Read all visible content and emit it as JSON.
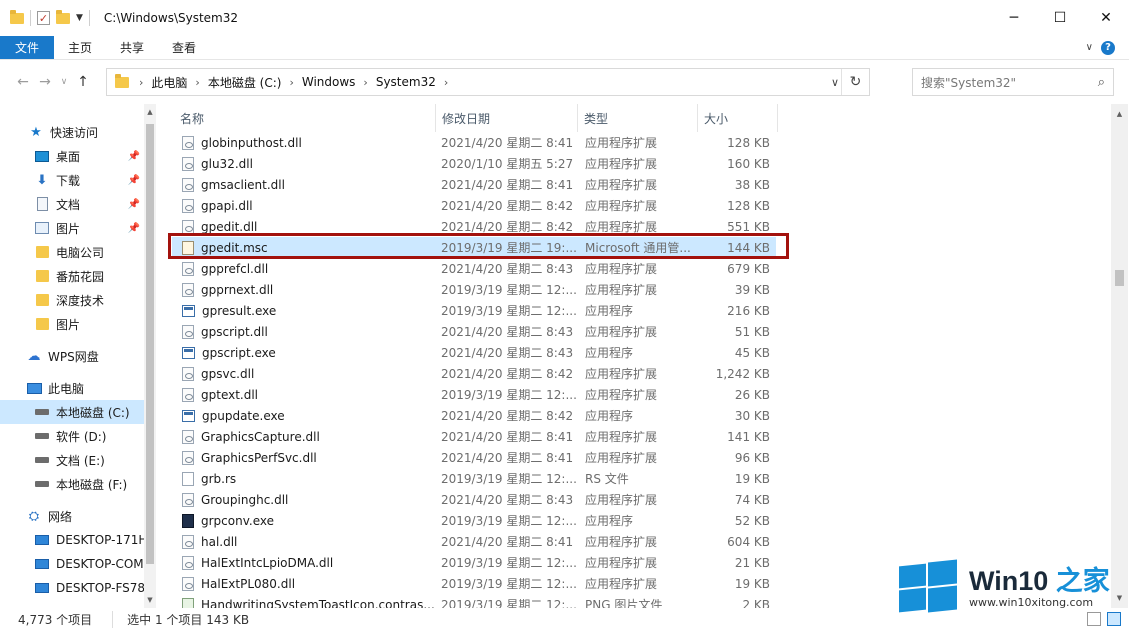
{
  "titlebar": {
    "path": "C:\\Windows\\System32",
    "min": "─",
    "max": "☐",
    "close": "✕"
  },
  "ribbon": {
    "tabs": [
      "文件",
      "主页",
      "共享",
      "查看"
    ],
    "help": "?"
  },
  "address": {
    "crumbs": [
      "此电脑",
      "本地磁盘 (C:)",
      "Windows",
      "System32"
    ],
    "search_placeholder": "搜索\"System32\""
  },
  "nav": [
    {
      "label": "快速访问",
      "icon": "star-icon"
    },
    {
      "label": "桌面",
      "icon": "desktop-icon",
      "pinned": true
    },
    {
      "label": "下载",
      "icon": "download-icon",
      "pinned": true
    },
    {
      "label": "文档",
      "icon": "document-icon",
      "pinned": true
    },
    {
      "label": "图片",
      "icon": "picture-icon",
      "pinned": true
    },
    {
      "label": "电脑公司",
      "icon": "folder-icon"
    },
    {
      "label": "番茄花园",
      "icon": "folder-icon"
    },
    {
      "label": "深度技术",
      "icon": "folder-icon"
    },
    {
      "label": "图片",
      "icon": "folder-icon"
    },
    {
      "label": "WPS网盘",
      "icon": "cloud-icon"
    },
    {
      "label": "此电脑",
      "icon": "computer-icon"
    },
    {
      "label": "本地磁盘 (C:)",
      "icon": "drive-icon",
      "selected": true
    },
    {
      "label": "软件 (D:)",
      "icon": "drive-icon"
    },
    {
      "label": "文档 (E:)",
      "icon": "drive-icon"
    },
    {
      "label": "本地磁盘 (F:)",
      "icon": "drive-icon"
    },
    {
      "label": "网络",
      "icon": "network-icon"
    },
    {
      "label": "DESKTOP-171H",
      "icon": "monitor-icon"
    },
    {
      "label": "DESKTOP-COM",
      "icon": "monitor-icon"
    },
    {
      "label": "DESKTOP-FS78",
      "icon": "monitor-icon"
    }
  ],
  "columns": {
    "name": "名称",
    "date": "修改日期",
    "type": "类型",
    "size": "大小"
  },
  "files": [
    {
      "name": "globinputhost.dll",
      "date": "2021/4/20 星期二 8:41",
      "type": "应用程序扩展",
      "size": "128 KB",
      "kind": "dll"
    },
    {
      "name": "glu32.dll",
      "date": "2020/1/10 星期五 5:27",
      "type": "应用程序扩展",
      "size": "160 KB",
      "kind": "dll"
    },
    {
      "name": "gmsaclient.dll",
      "date": "2021/4/20 星期二 8:41",
      "type": "应用程序扩展",
      "size": "38 KB",
      "kind": "dll"
    },
    {
      "name": "gpapi.dll",
      "date": "2021/4/20 星期二 8:42",
      "type": "应用程序扩展",
      "size": "128 KB",
      "kind": "dll"
    },
    {
      "name": "gpedit.dll",
      "date": "2021/4/20 星期二 8:42",
      "type": "应用程序扩展",
      "size": "551 KB",
      "kind": "dll"
    },
    {
      "name": "gpedit.msc",
      "date": "2019/3/19 星期二 19:...",
      "type": "Microsoft 通用管...",
      "size": "144 KB",
      "kind": "msc",
      "selected": true
    },
    {
      "name": "gpprefcl.dll",
      "date": "2021/4/20 星期二 8:43",
      "type": "应用程序扩展",
      "size": "679 KB",
      "kind": "dll"
    },
    {
      "name": "gpprnext.dll",
      "date": "2019/3/19 星期二 12:...",
      "type": "应用程序扩展",
      "size": "39 KB",
      "kind": "dll"
    },
    {
      "name": "gpresult.exe",
      "date": "2019/3/19 星期二 12:...",
      "type": "应用程序",
      "size": "216 KB",
      "kind": "exe"
    },
    {
      "name": "gpscript.dll",
      "date": "2021/4/20 星期二 8:43",
      "type": "应用程序扩展",
      "size": "51 KB",
      "kind": "dll"
    },
    {
      "name": "gpscript.exe",
      "date": "2021/4/20 星期二 8:43",
      "type": "应用程序",
      "size": "45 KB",
      "kind": "exe"
    },
    {
      "name": "gpsvc.dll",
      "date": "2021/4/20 星期二 8:42",
      "type": "应用程序扩展",
      "size": "1,242 KB",
      "kind": "dll"
    },
    {
      "name": "gptext.dll",
      "date": "2019/3/19 星期二 12:...",
      "type": "应用程序扩展",
      "size": "26 KB",
      "kind": "dll"
    },
    {
      "name": "gpupdate.exe",
      "date": "2021/4/20 星期二 8:42",
      "type": "应用程序",
      "size": "30 KB",
      "kind": "exe"
    },
    {
      "name": "GraphicsCapture.dll",
      "date": "2021/4/20 星期二 8:41",
      "type": "应用程序扩展",
      "size": "141 KB",
      "kind": "dll"
    },
    {
      "name": "GraphicsPerfSvc.dll",
      "date": "2021/4/20 星期二 8:41",
      "type": "应用程序扩展",
      "size": "96 KB",
      "kind": "dll"
    },
    {
      "name": "grb.rs",
      "date": "2019/3/19 星期二 12:...",
      "type": "RS 文件",
      "size": "19 KB",
      "kind": "rs"
    },
    {
      "name": "Groupinghc.dll",
      "date": "2021/4/20 星期二 8:43",
      "type": "应用程序扩展",
      "size": "74 KB",
      "kind": "dll"
    },
    {
      "name": "grpconv.exe",
      "date": "2019/3/19 星期二 12:...",
      "type": "应用程序",
      "size": "52 KB",
      "kind": "dark"
    },
    {
      "name": "hal.dll",
      "date": "2021/4/20 星期二 8:41",
      "type": "应用程序扩展",
      "size": "604 KB",
      "kind": "dll"
    },
    {
      "name": "HalExtIntcLpioDMA.dll",
      "date": "2019/3/19 星期二 12:...",
      "type": "应用程序扩展",
      "size": "21 KB",
      "kind": "dll"
    },
    {
      "name": "HalExtPL080.dll",
      "date": "2019/3/19 星期二 12:...",
      "type": "应用程序扩展",
      "size": "19 KB",
      "kind": "dll"
    },
    {
      "name": "HandwritingSystemToastIcon.contras...",
      "date": "2019/3/19 星期二 12:...",
      "type": "PNG 图片文件",
      "size": "2 KB",
      "kind": "png"
    }
  ],
  "status": {
    "count": "4,773 个项目",
    "selection": "选中 1 个项目  143 KB"
  },
  "watermark": {
    "title_a": "Win10",
    "title_b": " 之家",
    "url": "www.win10xitong.com"
  },
  "colors": {
    "accent": "#1979ca",
    "highlight_border": "#a3120d",
    "selection": "#cce8ff"
  }
}
